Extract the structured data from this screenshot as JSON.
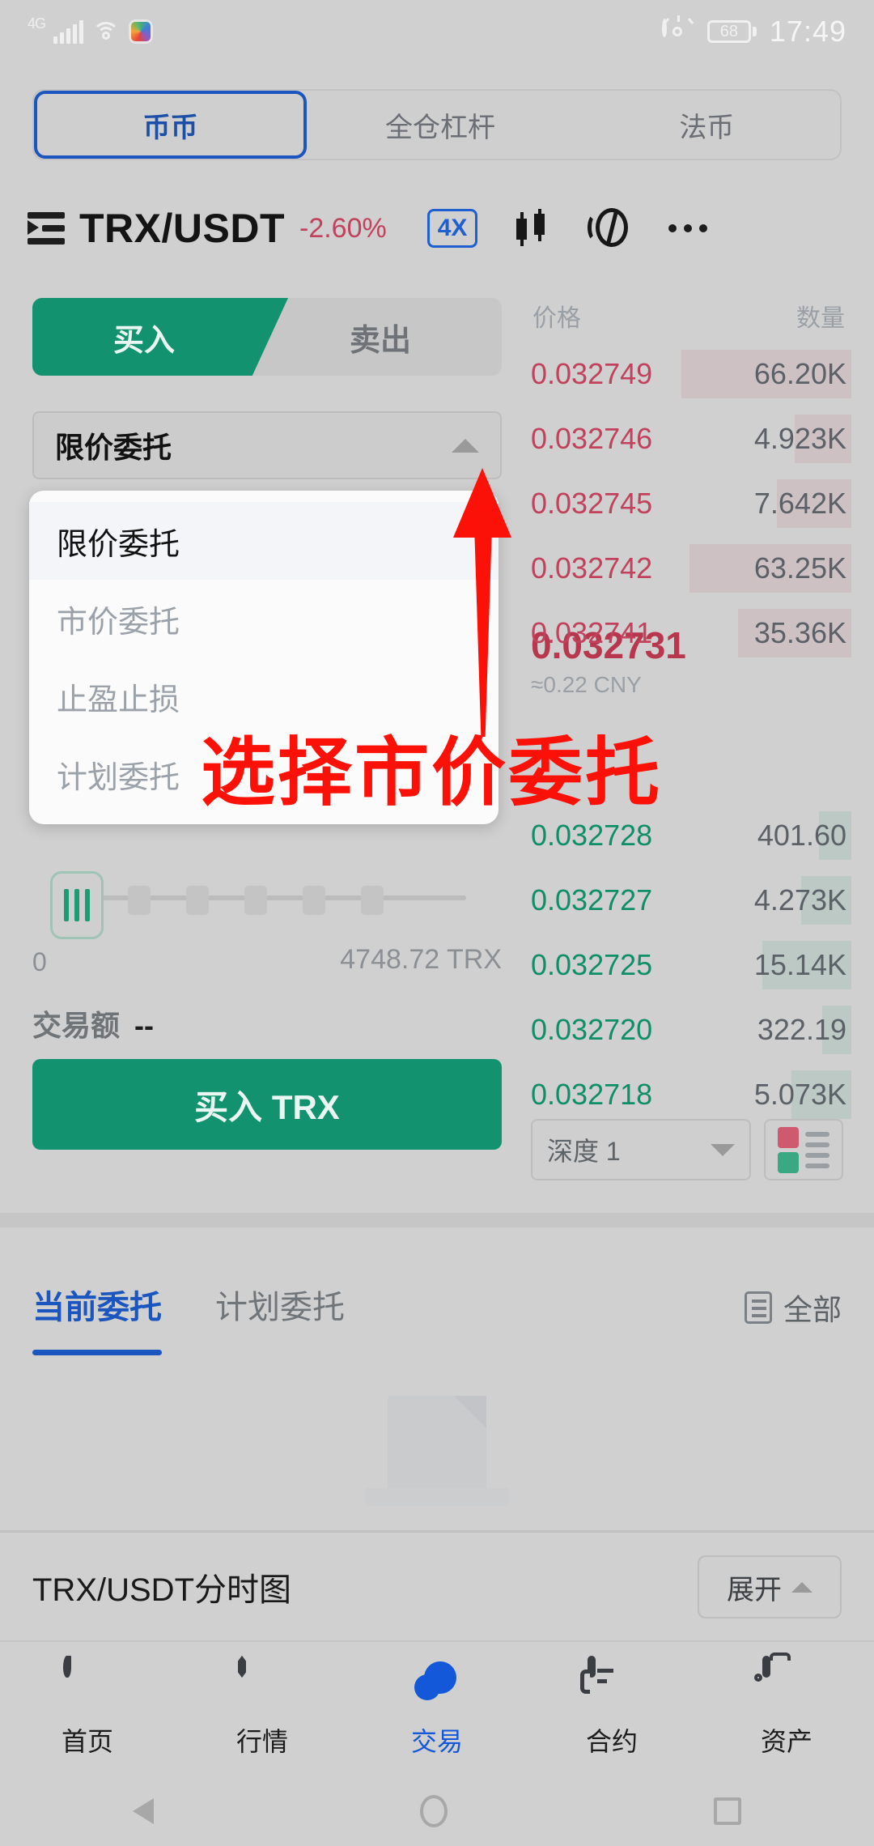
{
  "status_bar": {
    "network": "4G",
    "battery_percent": "68",
    "time": "17:49",
    "icons": [
      "signal-bars-icon",
      "wifi-icon",
      "app-badge-icon",
      "eye-comfort-icon",
      "battery-icon"
    ]
  },
  "top_tabs": [
    {
      "label": "币币",
      "active": true
    },
    {
      "label": "全仓杠杆",
      "active": false
    },
    {
      "label": "法币",
      "active": false
    }
  ],
  "pair_header": {
    "symbol": "TRX/USDT",
    "change_percent": "-2.60%",
    "leverage": "4X",
    "icons": [
      "pair-list-icon",
      "candlestick-icon",
      "depth-chart-icon",
      "more-dots-icon"
    ]
  },
  "trade_panel": {
    "buy_tab": "买入",
    "sell_tab": "卖出",
    "order_type_selected": "限价委托",
    "order_type_options": [
      {
        "label": "限价委托",
        "selected": true
      },
      {
        "label": "市价委托",
        "selected": false
      },
      {
        "label": "止盈止损",
        "selected": false
      },
      {
        "label": "计划委托",
        "selected": false
      }
    ],
    "slider_min": "0",
    "slider_max": "4748.72 TRX",
    "amount_label": "交易额",
    "amount_value": "--",
    "submit_label": "买入 TRX"
  },
  "order_book": {
    "col_price": "价格",
    "col_amount": "数量",
    "asks": [
      {
        "price": "0.032749",
        "amount": "66.20K",
        "depth": 62
      },
      {
        "price": "0.032746",
        "amount": "4.923K",
        "depth": 18
      },
      {
        "price": "0.032745",
        "amount": "7.642K",
        "depth": 24
      },
      {
        "price": "0.032742",
        "amount": "63.25K",
        "depth": 60
      },
      {
        "price": "0.032741",
        "amount": "35.36K",
        "depth": 38
      }
    ],
    "mid_price": "0.032731",
    "mid_price_cny": "≈0.22 CNY",
    "bids": [
      {
        "price": "0.032728",
        "amount": "401.60",
        "depth": 10
      },
      {
        "price": "0.032727",
        "amount": "4.273K",
        "depth": 16
      },
      {
        "price": "0.032725",
        "amount": "15.14K",
        "depth": 30
      },
      {
        "price": "0.032720",
        "amount": "322.19",
        "depth": 9
      },
      {
        "price": "0.032718",
        "amount": "5.073K",
        "depth": 20
      }
    ],
    "depth_selector": "深度 1",
    "book_layout_icon": "order-book-layout-icon"
  },
  "orders_section": {
    "tabs": [
      {
        "label": "当前委托",
        "active": true
      },
      {
        "label": "计划委托",
        "active": false
      }
    ],
    "filter_label": "全部",
    "filter_icon": "filter-list-icon"
  },
  "chart_bar": {
    "title": "TRX/USDT分时图",
    "expand_label": "展开"
  },
  "bottom_nav": [
    {
      "label": "首页",
      "icon": "flame-icon",
      "active": false
    },
    {
      "label": "行情",
      "icon": "market-hexagon-icon",
      "active": false
    },
    {
      "label": "交易",
      "icon": "trade-icon",
      "active": true
    },
    {
      "label": "合约",
      "icon": "contract-icon",
      "active": false
    },
    {
      "label": "资产",
      "icon": "wallet-icon",
      "active": false
    }
  ],
  "android_nav": [
    "back-icon",
    "home-icon",
    "recents-icon"
  ],
  "annotation": {
    "text": "选择市价委托",
    "color": "#fb1108",
    "arrow_icon": "up-arrow-annotation"
  }
}
